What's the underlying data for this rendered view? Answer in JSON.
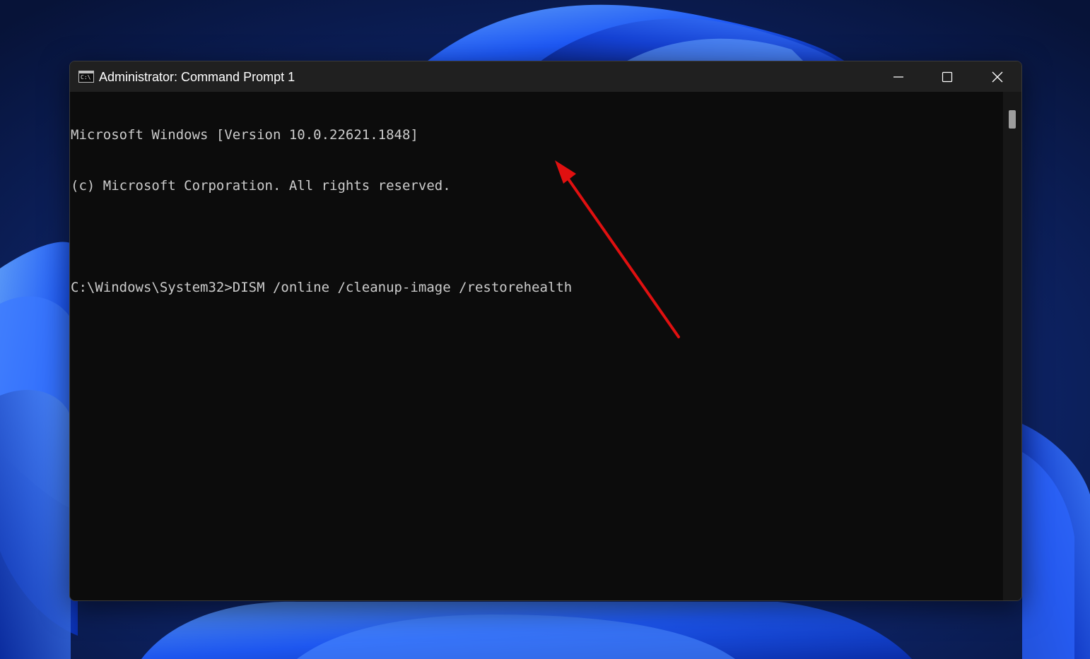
{
  "window": {
    "title": "Administrator: Command Prompt 1",
    "icon": "cmd-app-icon",
    "icon_text": "C:\\",
    "controls": {
      "minimize_icon": "minimize-icon",
      "maximize_icon": "maximize-icon",
      "close_icon": "close-icon"
    }
  },
  "console": {
    "lines": [
      "Microsoft Windows [Version 10.0.22621.1848]",
      "(c) Microsoft Corporation. All rights reserved.",
      "",
      "C:\\Windows\\System32>DISM /online /cleanup-image /restorehealth"
    ],
    "text_color": "#cccccc",
    "background_color": "#0c0c0c"
  },
  "annotation": {
    "type": "red-arrow",
    "color": "#e01010"
  },
  "colors": {
    "titlebar": "#202020",
    "wallpaper_accent": "#1f5cff"
  }
}
